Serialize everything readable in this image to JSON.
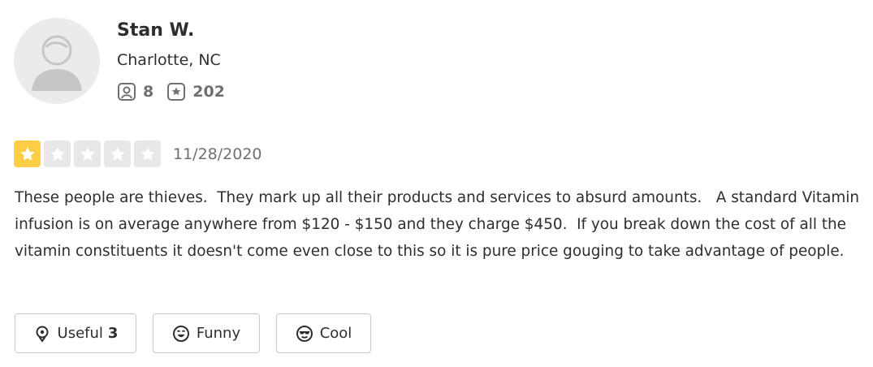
{
  "reviewer": {
    "name": "Stan W.",
    "location": "Charlotte, NC",
    "friends_count": "8",
    "reviews_count": "202",
    "avatar_icon": "default-user-avatar-icon",
    "friends_icon": "friends-icon",
    "reviews_icon": "review-star-icon"
  },
  "review": {
    "rating": 1,
    "rating_max": 5,
    "date": "11/28/2020",
    "text": "These people are thieves.  They mark up all their products and services to absurd amounts.   A standard Vitamin infusion is on average anywhere from $120 - $150 and they charge $450.  If you break down the cost of all the vitamin constituents it doesn't come even close to this so it is pure price gouging to take advantage of people."
  },
  "reactions": {
    "useful": {
      "label": "Useful",
      "count": "3",
      "icon": "lightbulb-icon"
    },
    "funny": {
      "label": "Funny",
      "icon": "laughing-face-icon"
    },
    "cool": {
      "label": "Cool",
      "icon": "sunglasses-face-icon"
    }
  },
  "colors": {
    "star_on": "#ffce46",
    "star_off": "#e8e8e8",
    "text": "#2d2e2f",
    "muted": "#6e7072",
    "border": "#c8c9ca"
  }
}
